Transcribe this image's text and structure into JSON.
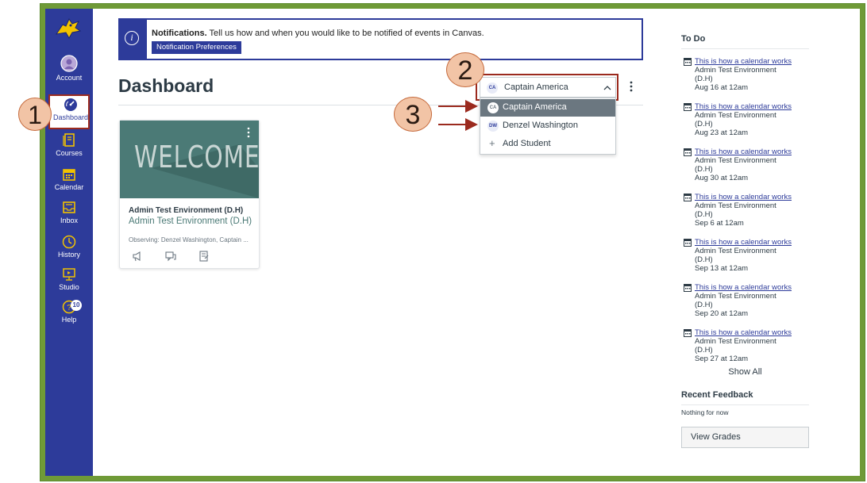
{
  "nav": {
    "items": [
      {
        "label": "Account",
        "icon": "account-icon"
      },
      {
        "label": "Dashboard",
        "icon": "dashboard-icon"
      },
      {
        "label": "Courses",
        "icon": "courses-icon"
      },
      {
        "label": "Calendar",
        "icon": "calendar-icon"
      },
      {
        "label": "Inbox",
        "icon": "inbox-icon"
      },
      {
        "label": "History",
        "icon": "history-icon"
      },
      {
        "label": "Studio",
        "icon": "studio-icon"
      },
      {
        "label": "Help",
        "icon": "help-icon"
      }
    ],
    "help_badge": "10",
    "colors": {
      "nav_bg": "#2d3b9a",
      "highlight": "#9b2a1e"
    }
  },
  "banner": {
    "title": "Notifications.",
    "text": "Tell us how and when you would like to be notified of events in Canvas.",
    "button": "Notification Preferences",
    "icon": "info-icon"
  },
  "main": {
    "title": "Dashboard",
    "selector": {
      "initials": "CA",
      "value": "Captain America",
      "chevron": "^"
    },
    "kebab": "⋮",
    "menu": {
      "items": [
        {
          "initials": "CA",
          "label": "Captain America",
          "selected": true
        },
        {
          "initials": "DW",
          "label": "Denzel Washington",
          "selected": false
        }
      ],
      "add_label": "Add Student"
    }
  },
  "card": {
    "hero_text": "WELCOME",
    "kebab": "⋮",
    "title": "Admin Test Environment (D.H)",
    "subtitle": "Admin Test Environment (D.H)",
    "observing": "Observing: Denzel Washington, Captain ...",
    "icons": [
      "announcements-icon",
      "discussions-icon",
      "assignments-icon"
    ],
    "hero_color": "#4b7a76"
  },
  "todo": {
    "title": "To Do",
    "items": [
      {
        "link": "This is how a calendar works",
        "course": "Admin Test Environment",
        "section": "(D.H)",
        "date": "Aug 16 at 12am"
      },
      {
        "link": "This is how a calendar works",
        "course": "Admin Test Environment",
        "section": "(D.H)",
        "date": "Aug 23 at 12am"
      },
      {
        "link": "This is how a calendar works",
        "course": "Admin Test Environment",
        "section": "(D.H)",
        "date": "Aug 30 at 12am"
      },
      {
        "link": "This is how a calendar works",
        "course": "Admin Test Environment",
        "section": "(D.H)",
        "date": "Sep 6 at 12am"
      },
      {
        "link": "This is how a calendar works",
        "course": "Admin Test Environment",
        "section": "(D.H)",
        "date": "Sep 13 at 12am"
      },
      {
        "link": "This is how a calendar works",
        "course": "Admin Test Environment",
        "section": "(D.H)",
        "date": "Sep 20 at 12am"
      },
      {
        "link": "This is how a calendar works",
        "course": "Admin Test Environment",
        "section": "(D.H)",
        "date": "Sep 27 at 12am"
      }
    ],
    "show_all": "Show All"
  },
  "feedback": {
    "title": "Recent Feedback",
    "empty": "Nothing for now",
    "button": "View Grades"
  },
  "annotations": {
    "callouts": [
      "1",
      "2",
      "3"
    ],
    "color": "#9b2a1e"
  }
}
